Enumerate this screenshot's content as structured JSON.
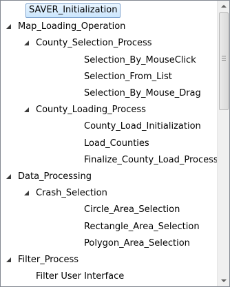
{
  "tree": {
    "items": [
      {
        "label": "SAVER_Initialization",
        "level": 0,
        "expander": "none",
        "selected": true
      },
      {
        "label": "Map_Loading_Operation",
        "level": 0,
        "expander": "expanded"
      },
      {
        "label": "County_Selection_Process",
        "level": 1,
        "expander": "expanded"
      },
      {
        "label": "Selection_By_MouseClick",
        "level": 2,
        "expander": "none"
      },
      {
        "label": "Selection_From_List",
        "level": 2,
        "expander": "none"
      },
      {
        "label": "Selection_By_Mouse_Drag",
        "level": 2,
        "expander": "none"
      },
      {
        "label": "County_Loading_Process",
        "level": 1,
        "expander": "expanded"
      },
      {
        "label": "County_Load_Initialization",
        "level": 2,
        "expander": "none"
      },
      {
        "label": "Load_Counties",
        "level": 2,
        "expander": "none"
      },
      {
        "label": "Finalize_County_Load_Process",
        "level": 2,
        "expander": "none"
      },
      {
        "label": "Data_Processing",
        "level": 0,
        "expander": "expanded"
      },
      {
        "label": "Crash_Selection",
        "level": 1,
        "expander": "expanded"
      },
      {
        "label": "Circle_Area_Selection",
        "level": 2,
        "expander": "none"
      },
      {
        "label": "Rectangle_Area_Selection",
        "level": 2,
        "expander": "none"
      },
      {
        "label": "Polygon_Area_Selection",
        "level": 2,
        "expander": "none"
      },
      {
        "label": "Filter_Process",
        "level": 0,
        "expander": "expanded"
      },
      {
        "label": "Filter User Interface",
        "level": 1,
        "expander": "none"
      }
    ]
  }
}
